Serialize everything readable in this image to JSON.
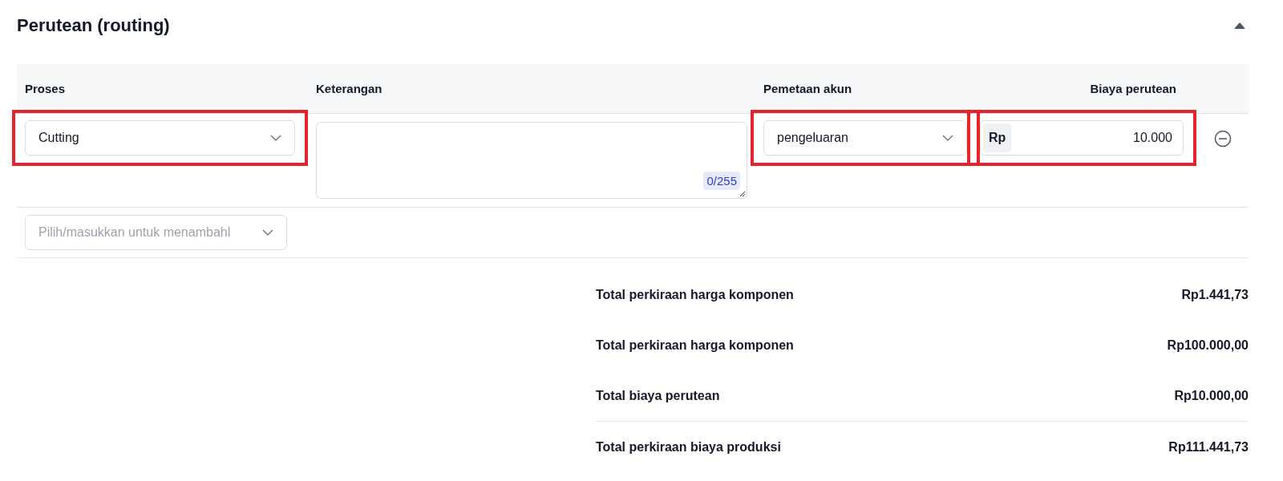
{
  "section": {
    "title": "Perutean (routing)",
    "expanded": true
  },
  "table": {
    "columns": [
      "Proses",
      "Keterangan",
      "Pemetaan akun",
      "Biaya perutean"
    ],
    "rows": [
      {
        "process": {
          "value": "Cutting",
          "highlighted": true
        },
        "note": {
          "counter": "0/255"
        },
        "account": {
          "value": "pengeluaran",
          "highlighted": true
        },
        "cost": {
          "prefix": "Rp",
          "value": "10.000",
          "highlighted": true
        }
      }
    ]
  },
  "add_select": {
    "placeholder": "Pilih/masukkan untuk menambahl"
  },
  "totals": [
    {
      "label": "Total perkiraan harga komponen",
      "value": "Rp1.441,73"
    },
    {
      "label": "Total perkiraan harga komponen",
      "value": "Rp100.000,00"
    },
    {
      "label": "Total biaya perutean",
      "value": "Rp10.000,00"
    }
  ],
  "grand_total": {
    "label": "Total perkiraan biaya produksi",
    "value": "Rp111.441,73"
  }
}
